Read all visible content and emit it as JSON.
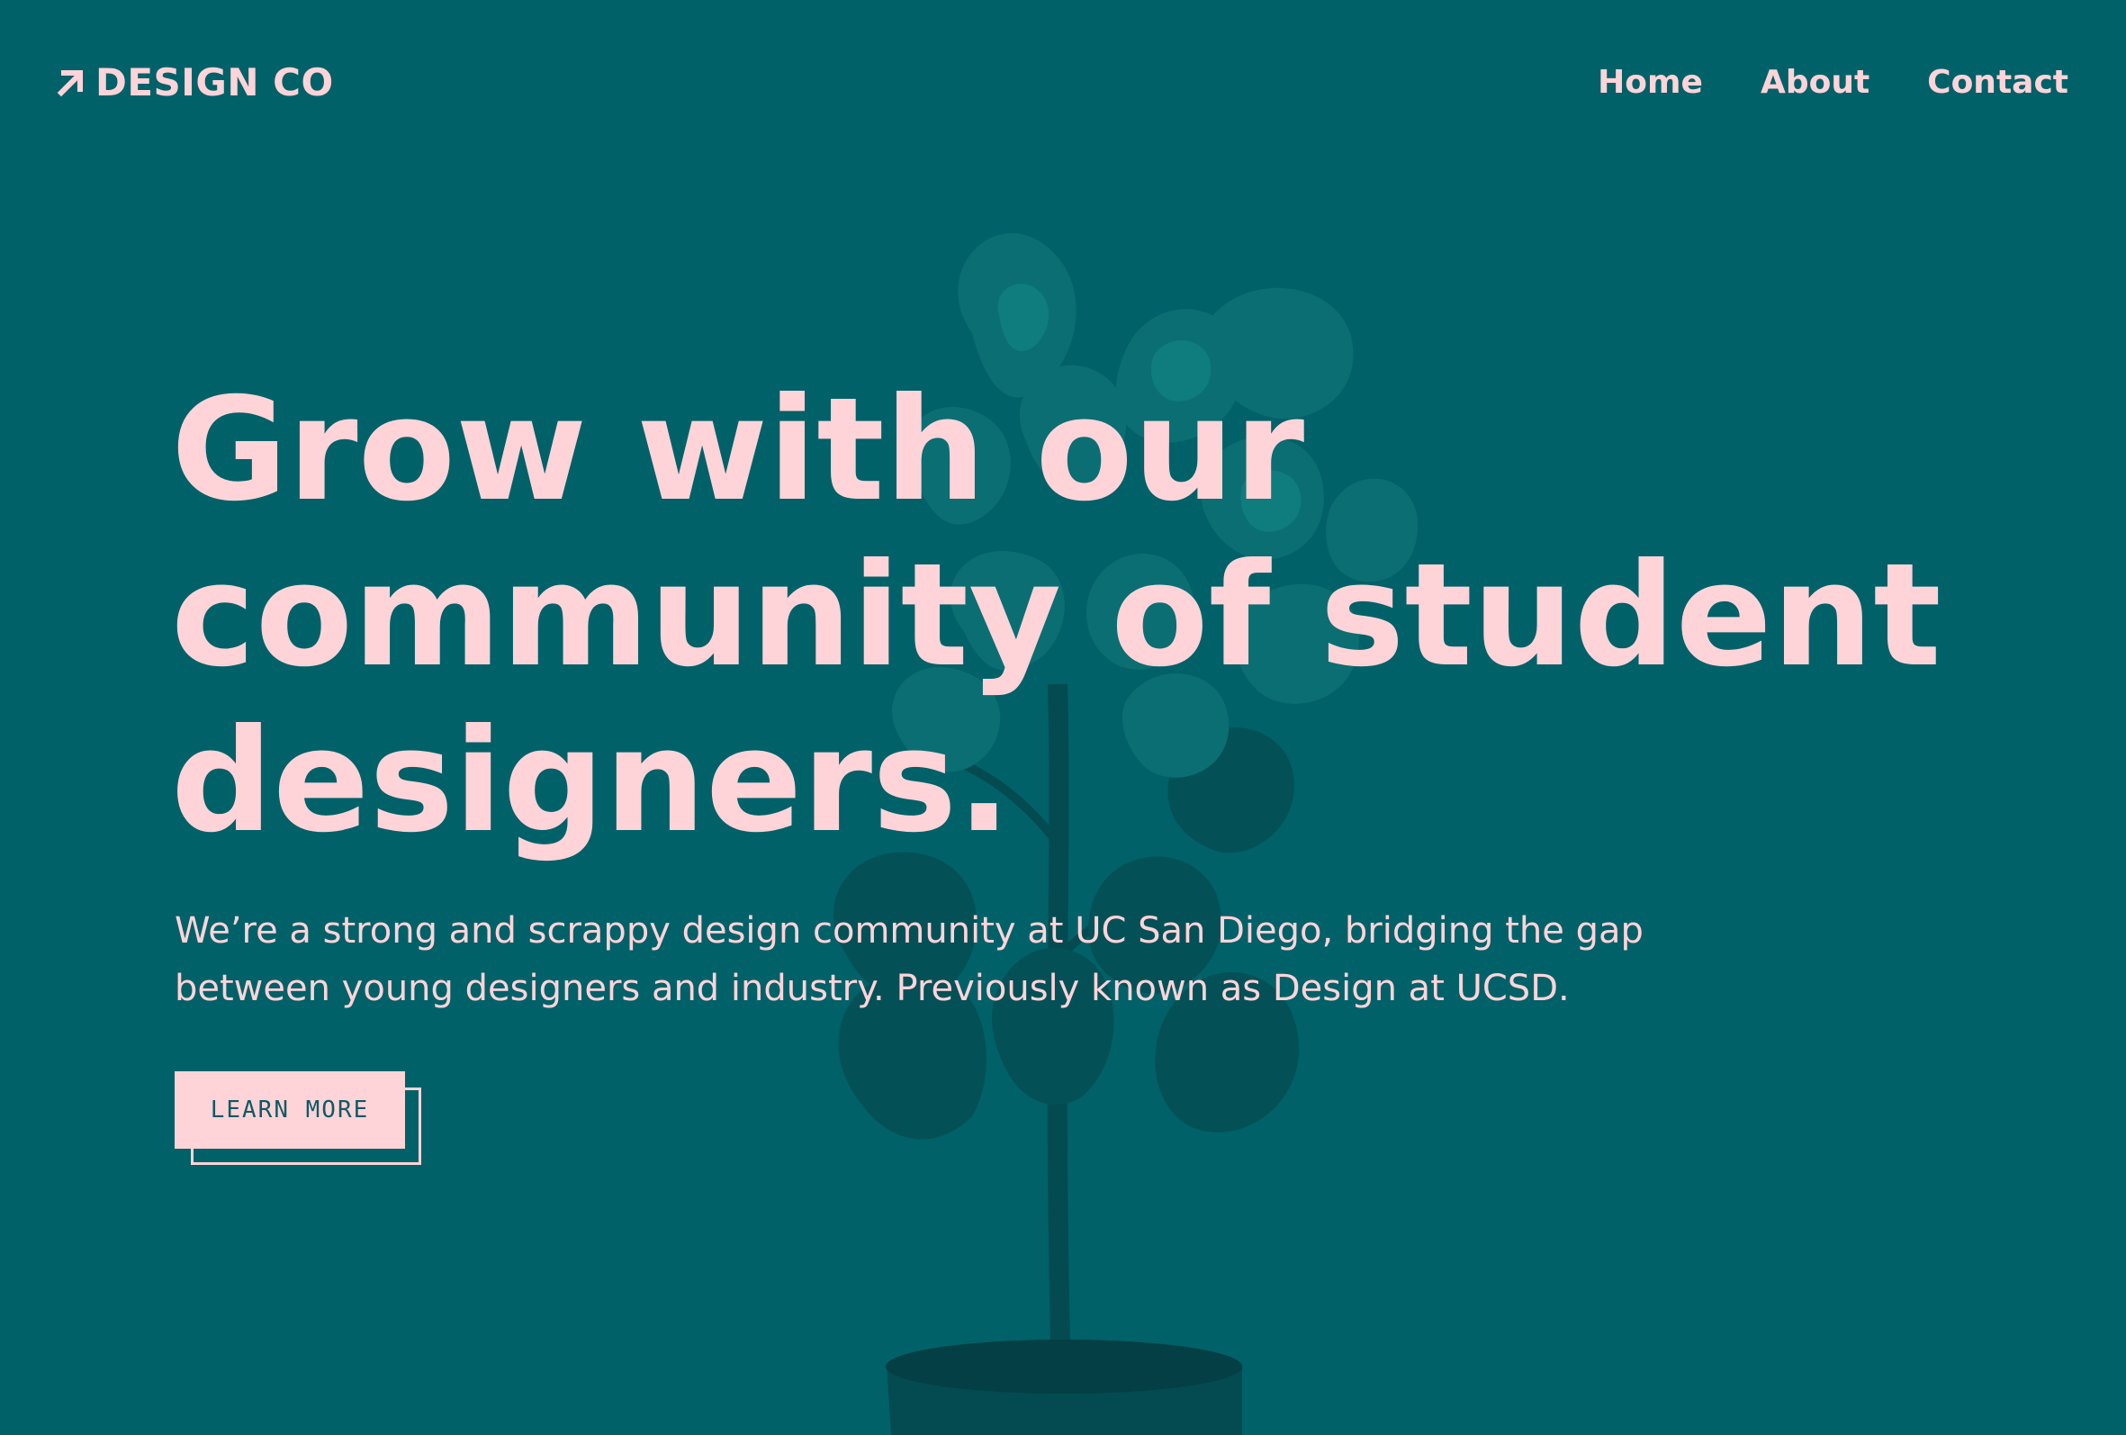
{
  "colors": {
    "background": "#006168",
    "accent_pink": "#ffd4d9",
    "plant_dark": "#004f55",
    "plant_mid": "#0b7a7d",
    "button_text": "#0f5a63"
  },
  "header": {
    "logo": {
      "icon": "arrow-up-right-icon",
      "text": "DESIGN CO"
    },
    "nav": [
      {
        "label": "Home"
      },
      {
        "label": "About"
      },
      {
        "label": "Contact"
      }
    ]
  },
  "hero": {
    "title_lines": [
      "Grow with our",
      "community of student",
      "designers."
    ],
    "subtitle_lines": [
      "We’re a strong and scrappy design community at UC San Diego, bridging the gap",
      "between young designers and industry. Previously known as Design at UCSD."
    ],
    "button_label": "LEARN MORE",
    "background_image": "potted-plant-illustration"
  }
}
